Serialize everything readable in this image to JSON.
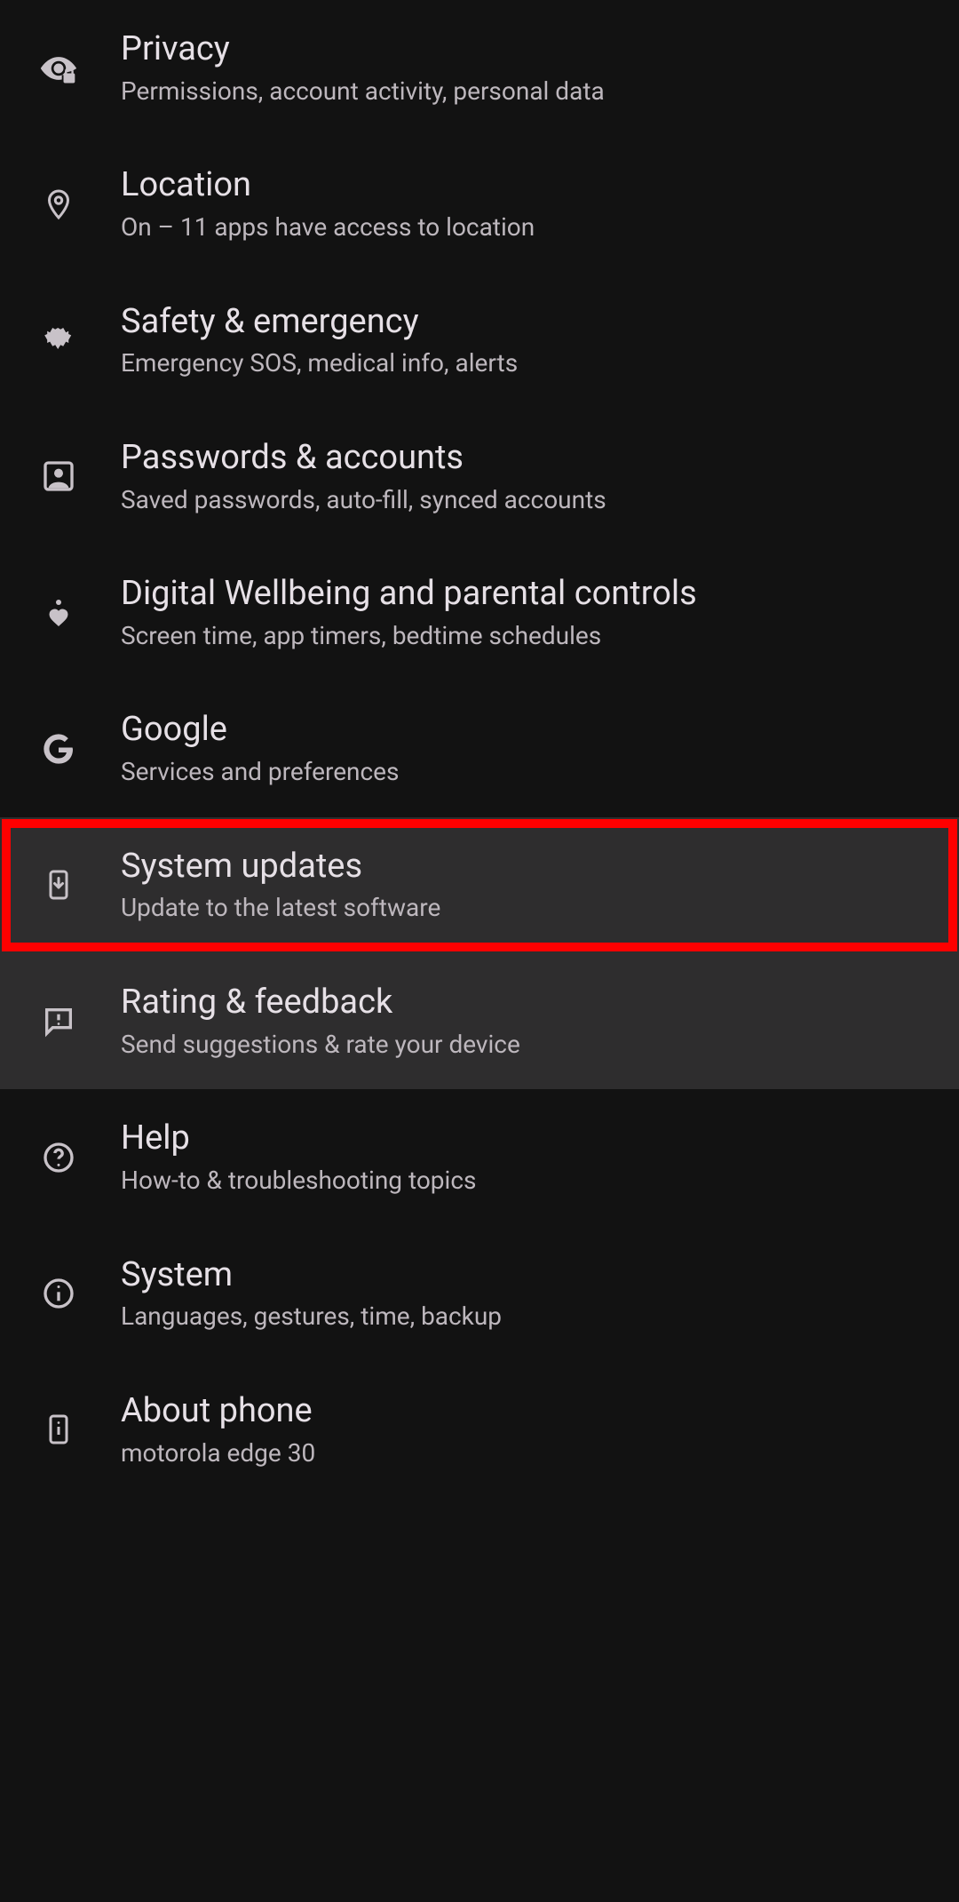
{
  "settings": {
    "items": [
      {
        "icon": "eye-lock-icon",
        "title": "Privacy",
        "subtitle": "Permissions, account activity, personal data"
      },
      {
        "icon": "location-icon",
        "title": "Location",
        "subtitle": "On – 11 apps have access to location"
      },
      {
        "icon": "medical-icon",
        "title": "Safety & emergency",
        "subtitle": "Emergency SOS, medical info, alerts"
      },
      {
        "icon": "account-box-icon",
        "title": "Passwords & accounts",
        "subtitle": "Saved passwords, auto-fill, synced accounts"
      },
      {
        "icon": "wellbeing-icon",
        "title": "Digital Wellbeing and parental controls",
        "subtitle": "Screen time, app timers, bedtime schedules"
      },
      {
        "icon": "google-icon",
        "title": "Google",
        "subtitle": "Services and preferences"
      },
      {
        "icon": "phone-download-icon",
        "title": "System updates",
        "subtitle": "Update to the latest software"
      },
      {
        "icon": "feedback-icon",
        "title": "Rating & feedback",
        "subtitle": "Send suggestions & rate your device"
      },
      {
        "icon": "help-icon",
        "title": "Help",
        "subtitle": "How-to & troubleshooting topics"
      },
      {
        "icon": "info-icon",
        "title": "System",
        "subtitle": "Languages, gestures, time, backup"
      },
      {
        "icon": "phone-info-icon",
        "title": "About phone",
        "subtitle": "motorola edge 30"
      }
    ]
  },
  "highlight_index": 6,
  "group_dark_start": 6,
  "group_dark_end": 7
}
